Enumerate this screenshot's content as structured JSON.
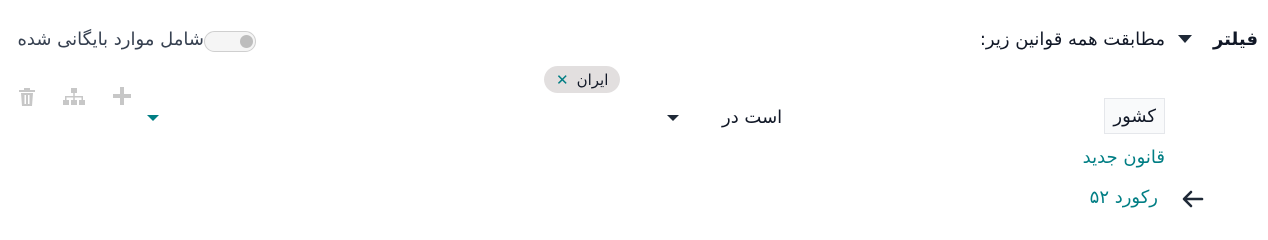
{
  "header": {
    "title": "فیلتر",
    "match_text": "مطابقت همه قوانین زیر:",
    "archived_label": "شامل موارد بایگانی شده"
  },
  "rule": {
    "field": "کشور",
    "operator": "است در",
    "value_tag": "ایران",
    "tag_remove": "✕"
  },
  "actions": {
    "new_rule_label": "قانون جدید",
    "records_label": "۵۲ رکورد"
  },
  "colors": {
    "accent": "#017e84",
    "muted_icon": "#c7c7c7",
    "tag_bg": "#e2dfdf"
  }
}
